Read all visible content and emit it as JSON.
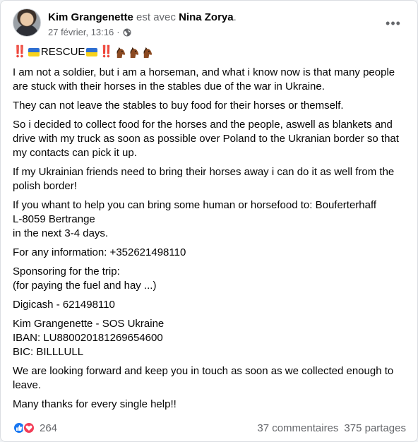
{
  "post": {
    "author": "Kim Grangenette",
    "with_text": "est avec",
    "tagged": "Nina Zorya",
    "tagged_suffix": ".",
    "date": "27 février, 13:16",
    "date_separator": "·",
    "privacy_icon": "globe-icon",
    "more_icon": "more-options-icon",
    "more_label": "•••",
    "headline_word": "RESCUE",
    "headline_bang": "‼️",
    "headline_emoji_names": [
      "double-exclamation",
      "ukraine-flag",
      "ukraine-flag",
      "double-exclamation",
      "horse-face",
      "horse-face",
      "horse-face"
    ],
    "paragraphs": [
      "I am not a soldier, but i am a horseman, and what i know now is that many people are stuck with their horses in the stables due of the war in Ukraine.",
      "They can not leave the stables to buy food for their horses or themself.",
      "So i decided to collect food for the horses and the people, aswell as blankets and drive with my truck as soon as possible over Poland to the Ukranian border so that my contacts can pick it up.",
      "If my Ukrainian friends need to bring their horses away i can do it as well from the polish border!"
    ],
    "address_block": [
      "If you whant to help you can bring some human or horsefood to: Bouferterhaff",
      "L-8059 Bertrange",
      "in the next 3-4 days."
    ],
    "info_line": "For any information: +352621498110",
    "sponsor_block": [
      "Sponsoring for the trip:",
      "(for paying the fuel and hay ...)"
    ],
    "digicash": "Digicash - 621498110",
    "bank_block": [
      "Kim Grangenette - SOS Ukraine",
      "IBAN: LU880020181269654600",
      "BIC: BILLLULL"
    ],
    "closing": "We are looking forward and keep you in touch as soon as we collected enough to leave.",
    "thanks": "Many thanks for every single help!!"
  },
  "footer": {
    "reaction_icons": [
      "like-icon",
      "love-icon"
    ],
    "reaction_count": "264",
    "comments": "37 commentaires",
    "shares": "375 partages"
  },
  "colors": {
    "like": "#1877f2",
    "love": "#f33e58",
    "muted": "#65676b",
    "ukraine_blue": "#2f6fd1",
    "ukraine_yellow": "#f7d21c"
  }
}
